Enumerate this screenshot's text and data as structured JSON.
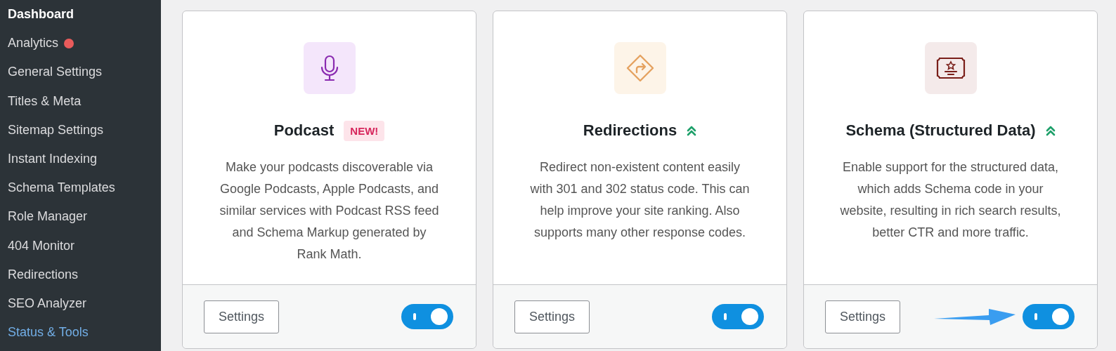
{
  "sidebar": {
    "items": [
      {
        "label": "Dashboard",
        "selected": false,
        "kind": "heading"
      },
      {
        "label": "Analytics",
        "selected": false,
        "kind": "item",
        "color": "#e95b5b"
      },
      {
        "label": "General Settings",
        "selected": false,
        "kind": "item"
      },
      {
        "label": "Titles & Meta",
        "selected": false,
        "kind": "item"
      },
      {
        "label": "Sitemap Settings",
        "selected": false,
        "kind": "item"
      },
      {
        "label": "Instant Indexing",
        "selected": false,
        "kind": "item"
      },
      {
        "label": "Schema Templates",
        "selected": false,
        "kind": "item"
      },
      {
        "label": "Role Manager",
        "selected": false,
        "kind": "item"
      },
      {
        "label": "404 Monitor",
        "selected": false,
        "kind": "item"
      },
      {
        "label": "Redirections",
        "selected": false,
        "kind": "item"
      },
      {
        "label": "SEO Analyzer",
        "selected": false,
        "kind": "item"
      },
      {
        "label": "Status & Tools",
        "selected": true,
        "kind": "item"
      }
    ]
  },
  "modules": [
    {
      "kind": "microphone",
      "title": "Podcast",
      "badge": {
        "kind": "new",
        "text": "NEW!"
      },
      "description": "Make your podcasts discoverable via Google Podcasts, Apple Podcasts, and similar services with Podcast RSS feed and Schema Markup generated by Rank Math.",
      "button": "Settings",
      "on": true
    },
    {
      "kind": "sign",
      "title": "Redirections",
      "badge": {
        "kind": "upgrade"
      },
      "description": "Redirect non-existent content easily with 301 and 302 status code. This can help improve your site ranking. Also supports many other response codes.",
      "button": "Settings",
      "on": true
    },
    {
      "kind": "certificate",
      "title": "Schema (Structured Data)",
      "badge": {
        "kind": "upgrade"
      },
      "description": "Enable support for the structured data, which adds Schema code in your website, resulting in rich search results, better CTR and more traffic.",
      "button": "Settings",
      "on": true,
      "pointed": true
    }
  ]
}
